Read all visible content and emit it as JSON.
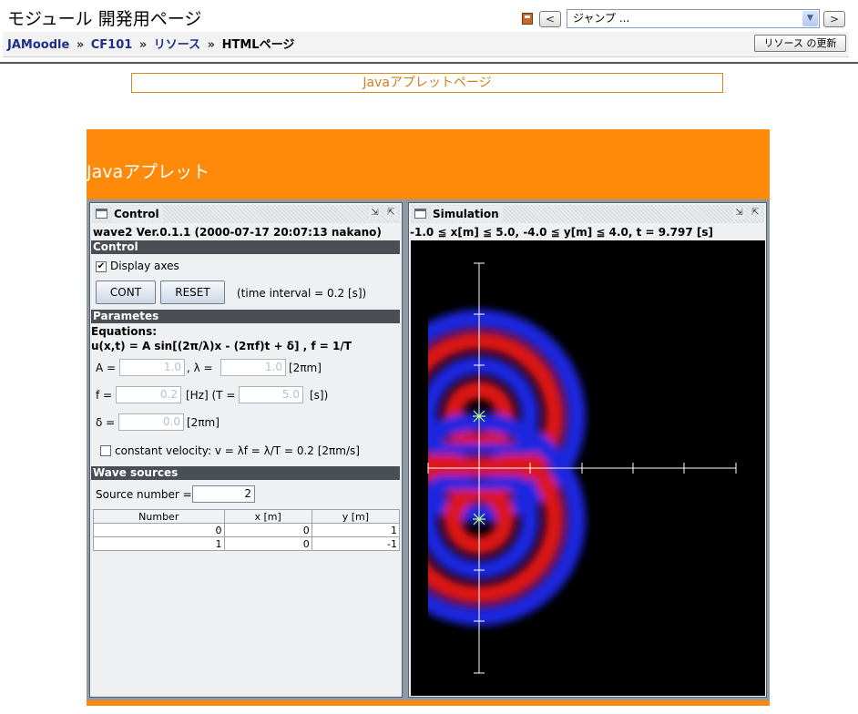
{
  "header": {
    "site_title": "モジュール 開発用ページ",
    "jump_select": "ジャンプ ...",
    "breadcrumb": [
      {
        "label": "JAMoodle"
      },
      {
        "label": "CF101"
      },
      {
        "label": "リソース"
      },
      {
        "label": "HTMLページ"
      }
    ],
    "separator": "»",
    "update_button": "リソース の更新",
    "prev_glyph": "<",
    "next_glyph": ">"
  },
  "page": {
    "title": "Javaアプレットページ",
    "banner_title": "Javaアプレット"
  },
  "colors": {
    "banner": "#ff8a0a",
    "link": "#1c2f8a",
    "wave_red": "#dd1818",
    "wave_blue": "#1e28e0"
  },
  "control": {
    "window_title": "Control",
    "version": "wave2 Ver.0.1.1 (2000-07-17 20:07:13 nakano)",
    "section_control": "Control",
    "display_axes_label": "Display axes",
    "display_axes_checked": true,
    "cont_button": "CONT",
    "reset_button": "RESET",
    "time_interval": "(time interval = 0.2 [s])",
    "section_parameters": "Parametes",
    "equations_label": "Equations:",
    "equation": "u(x,t) = A sin[(2π/λ)x - (2πf)t + δ] ,    f = 1/T",
    "A_label": "A =",
    "A_value": "1.0",
    "lambda_label": ",  λ =",
    "lambda_value": "1.0",
    "lambda_unit": "[2πm]",
    "f_label": "f =",
    "f_value": "0.2",
    "f_unit": "[Hz]  (T =",
    "T_value": "5.0",
    "T_unit": "[s])",
    "delta_label": "δ =",
    "delta_value": "0.0",
    "delta_unit": "[2πm]",
    "const_velocity_label": "constant velocity: v = λf = λ/T = 0.2 [2πm/s]",
    "const_velocity_checked": false,
    "section_sources": "Wave sources",
    "source_number_label": "Source number =",
    "source_number": "2",
    "table": {
      "headers": [
        "Number",
        "x [m]",
        "y [m]"
      ],
      "rows": [
        [
          "0",
          "0",
          "1"
        ],
        [
          "1",
          "0",
          "-1"
        ]
      ]
    }
  },
  "simulation": {
    "window_title": "Simulation",
    "status": "-1.0 ≦ x[m] ≦ 5.0, -4.0 ≦ y[m] ≦ 4.0, t = 9.797 [s]",
    "sources": [
      {
        "x": 0,
        "y": 1
      },
      {
        "x": 0,
        "y": -1
      }
    ]
  }
}
